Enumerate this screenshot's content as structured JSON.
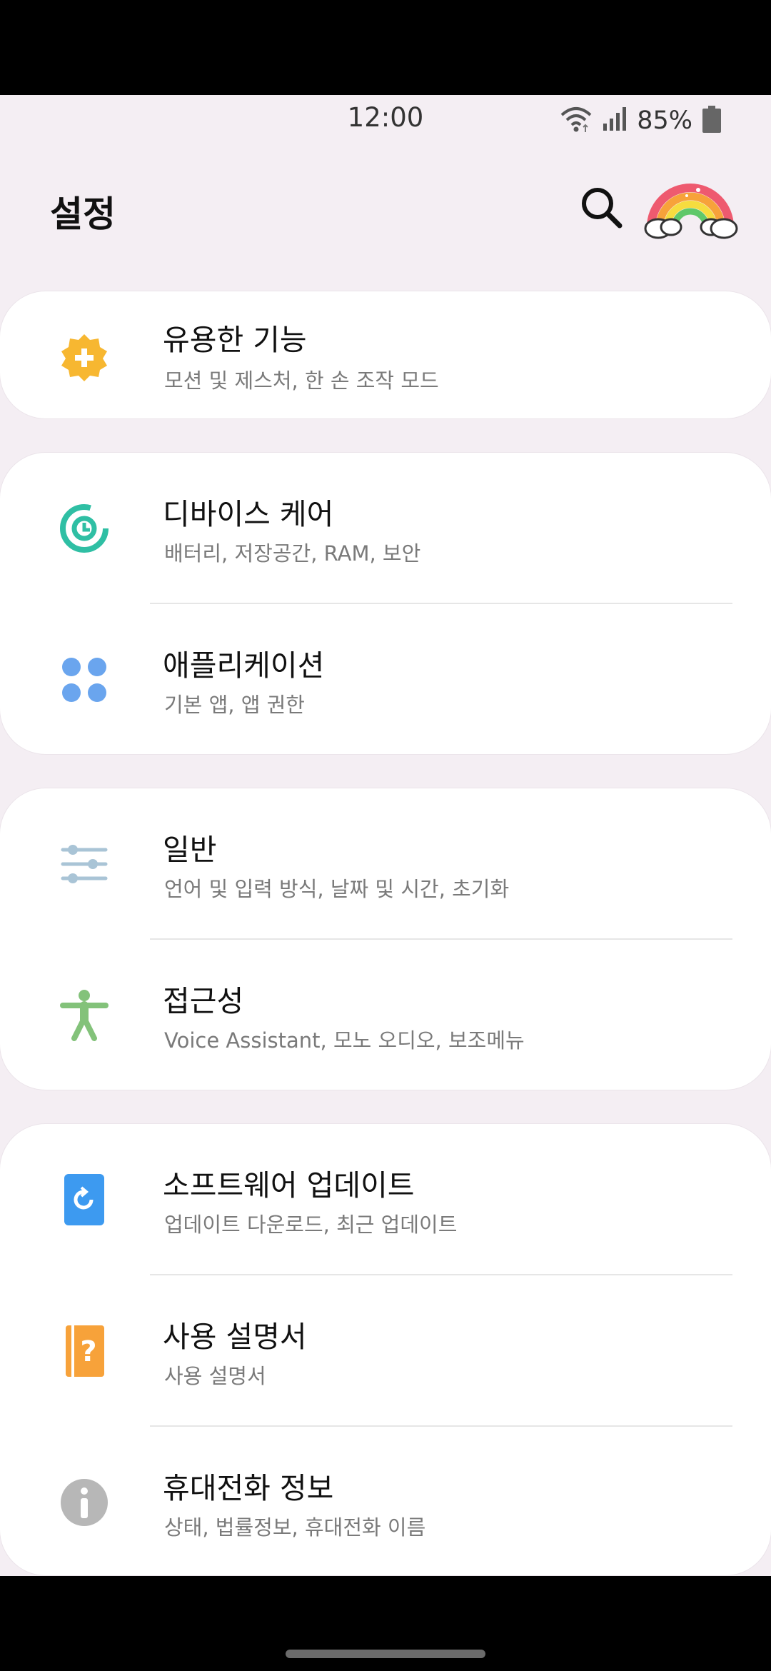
{
  "status_bar": {
    "time": "12:00",
    "battery_percent": "85%",
    "icons": [
      "wifi-icon",
      "signal-icon",
      "battery-icon"
    ]
  },
  "header": {
    "title": "설정",
    "search_icon": "search-icon",
    "avatar_icon": "rainbow-avatar-icon"
  },
  "menu": {
    "advanced": {
      "title": "유용한 기능",
      "subtitle": "모션 및 제스처, 한 손 조작 모드",
      "icon": "gear-plus-icon",
      "color": "#f7b731"
    },
    "device_care": {
      "title": "디바이스 케어",
      "subtitle": "배터리, 저장공간, RAM, 보안",
      "icon": "device-care-icon",
      "color": "#2fbfa4"
    },
    "apps": {
      "title": "애플리케이션",
      "subtitle": "기본 앱, 앱 권한",
      "icon": "apps-grid-icon",
      "color": "#6aa5ee"
    },
    "general": {
      "title": "일반",
      "subtitle": "언어 및 입력 방식, 날짜 및 시간, 초기화",
      "icon": "sliders-icon",
      "color": "#a9c4d6"
    },
    "accessibility": {
      "title": "접근성",
      "subtitle": "Voice Assistant, 모노 오디오, 보조메뉴",
      "icon": "accessibility-icon",
      "color": "#83c27a"
    },
    "software_update": {
      "title": "소프트웨어 업데이트",
      "subtitle": "업데이트 다운로드, 최근 업데이트",
      "icon": "software-update-icon",
      "color": "#3d9af0"
    },
    "user_manual": {
      "title": "사용 설명서",
      "subtitle": "사용 설명서",
      "icon": "user-manual-icon",
      "color": "#f7a23a"
    },
    "about_phone": {
      "title": "휴대전화 정보",
      "subtitle": "상태, 법률정보, 휴대전화 이름",
      "icon": "info-icon",
      "color": "#b7b7b7"
    }
  }
}
